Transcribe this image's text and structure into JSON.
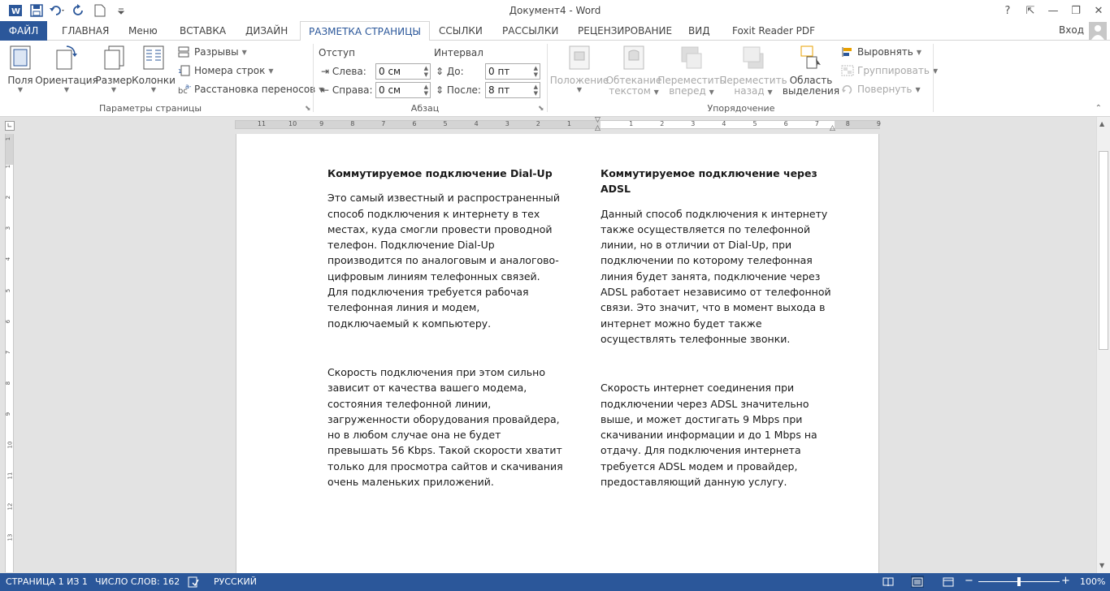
{
  "window": {
    "title": "Документ4 - Word",
    "signin": "Вход",
    "help": "?",
    "controls": {
      "restore_ribbon": "⇱",
      "minimize": "—",
      "maximize": "❐",
      "close": "✕"
    }
  },
  "colors": {
    "accent": "#2b579a",
    "ribbon_bg": "#ffffff",
    "workspace": "#e3e3e3"
  },
  "tabs": [
    {
      "label": "ФАЙЛ"
    },
    {
      "label": "ГЛАВНАЯ"
    },
    {
      "label": "Меню"
    },
    {
      "label": "ВСТАВКА"
    },
    {
      "label": "ДИЗАЙН"
    },
    {
      "label": "РАЗМЕТКА СТРАНИЦЫ"
    },
    {
      "label": "ССЫЛКИ"
    },
    {
      "label": "РАССЫЛКИ"
    },
    {
      "label": "РЕЦЕНЗИРОВАНИЕ"
    },
    {
      "label": "ВИД"
    },
    {
      "label": "Foxit Reader PDF"
    }
  ],
  "ribbon": {
    "page_setup": {
      "label": "Параметры страницы",
      "margins": "Поля",
      "orientation": "Ориентация",
      "size": "Размер",
      "columns": "Колонки",
      "breaks": "Разрывы",
      "line_numbers": "Номера строк",
      "hyphenation": "Расстановка переносов"
    },
    "paragraph": {
      "label": "Абзац",
      "indent_head": "Отступ",
      "spacing_head": "Интервал",
      "left_label": "Слева:",
      "right_label": "Справа:",
      "before_label": "До:",
      "after_label": "После:",
      "left_value": "0 см",
      "right_value": "0 см",
      "before_value": "0 пт",
      "after_value": "8 пт"
    },
    "arrange": {
      "label": "Упорядочение",
      "position": "Положение",
      "wrap_text_1": "Обтекание",
      "wrap_text_2": "текстом",
      "bring_forward_1": "Переместить",
      "bring_forward_2": "вперед",
      "send_backward_1": "Переместить",
      "send_backward_2": "назад",
      "selection_pane_1": "Область",
      "selection_pane_2": "выделения",
      "align": "Выровнять",
      "group": "Группировать",
      "rotate": "Повернуть"
    }
  },
  "ruler": {
    "h_ticks_left": [
      "11",
      "10",
      "9",
      "8",
      "7",
      "6",
      "5",
      "4",
      "3",
      "2",
      "1"
    ],
    "h_ticks_right": [
      "1",
      "2",
      "3",
      "4",
      "5",
      "6",
      "7",
      "8",
      "9"
    ],
    "v_ticks": [
      "1",
      "1",
      "2",
      "3",
      "4",
      "5",
      "6",
      "7",
      "8",
      "9",
      "10",
      "11",
      "12",
      "13"
    ]
  },
  "document": {
    "left": {
      "heading": "Коммутируемое подключение Dial-Up",
      "p1": "Это самый известный и распространенный способ подключения к интернету в тех местах, куда смогли провести проводной телефон. Подключение Dial-Up производится по аналоговым и аналогово-цифровым линиям телефонных связей. Для подключения требуется рабочая телефонная линия и модем, подключаемый к компьютеру.",
      "p2": "Скорость подключения при этом сильно зависит от качества вашего модема, состояния телефонной линии, загруженности оборудования провайдера, но в любом случае она не будет превышать 56 Kbps. Такой скорости хватит только для просмотра сайтов и скачивания очень маленьких приложений."
    },
    "right": {
      "heading": "Коммутируемое подключение через ADSL",
      "p1": "Данный способ подключения к интернету также осуществляется по телефонной линии, но в отличии от Dial-Up, при подключении по которому телефонная линия будет занята, подключение через ADSL работает независимо от телефонной связи. Это значит, что в момент выхода в интернет можно будет также осуществлять телефонные звонки.",
      "p2": "Скорость интернет соединения при подключении через ADSL значительно выше, и может достигать 9 Mbps при скачивании информации и до 1 Mbps на отдачу. Для подключения интернета требуется ADSL модем и провайдер, предоставляющий данную услугу."
    }
  },
  "status": {
    "page": "СТРАНИЦА 1 ИЗ 1",
    "words": "ЧИСЛО СЛОВ: 162",
    "language": "РУССКИЙ",
    "zoom_minus": "−",
    "zoom_plus": "+",
    "zoom": "100%",
    "zoom_percent": 100
  }
}
